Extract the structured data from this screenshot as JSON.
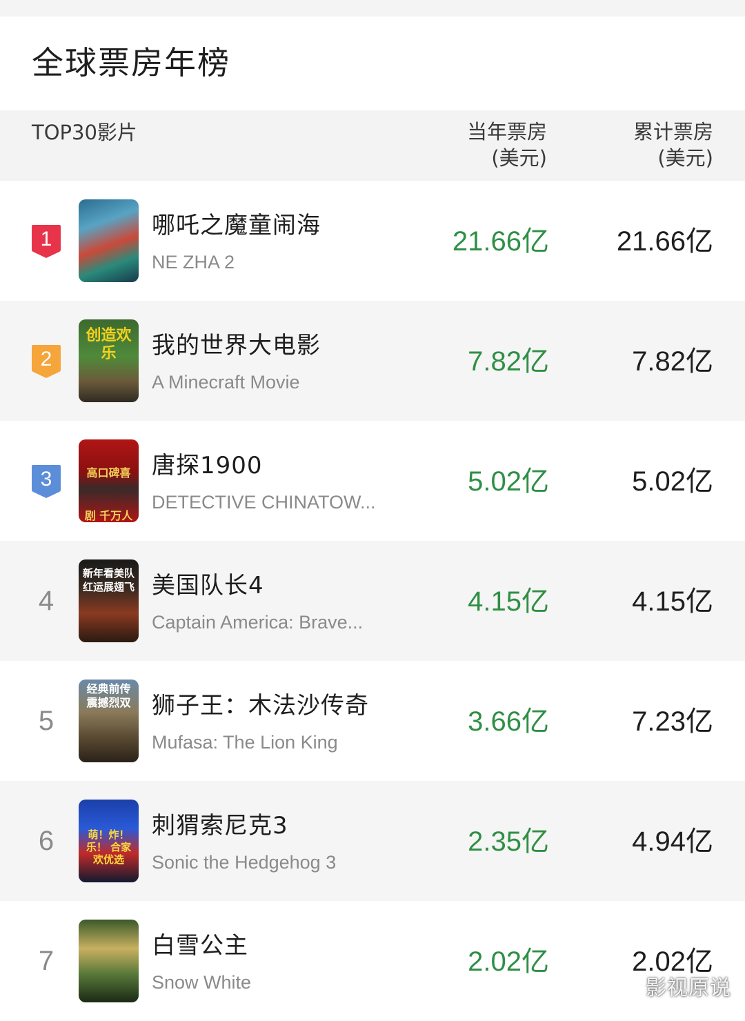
{
  "page": {
    "title": "全球票房年榜"
  },
  "table_header": {
    "film_col": "TOP30影片",
    "year_col": [
      "当年票房",
      "(美元)"
    ],
    "total_col": [
      "累计票房",
      "(美元)"
    ]
  },
  "colors": {
    "rank1": "#e8344a",
    "rank2": "#f5a53a",
    "rank3": "#5b8dd9",
    "green_value": "#2f8f45"
  },
  "movies": [
    {
      "rank": "1",
      "cn": "哪吒之魔童闹海",
      "en": "NE ZHA 2",
      "year": "21.66亿",
      "total": "21.66亿",
      "poster_text": ""
    },
    {
      "rank": "2",
      "cn": "我的世界大电影",
      "en": "A Minecraft Movie",
      "year": "7.82亿",
      "total": "7.82亿",
      "poster_text": "创造欢乐"
    },
    {
      "rank": "3",
      "cn": "唐探1900",
      "en": "DETECTIVE CHINATOW...",
      "year": "5.02亿",
      "total": "5.02亿",
      "poster_text": "高口碑喜剧 千万人催笑"
    },
    {
      "rank": "4",
      "cn": "美国队长4",
      "en": "Captain America: Brave...",
      "year": "4.15亿",
      "total": "4.15亿",
      "poster_text": "新年看美队 红运展翅飞"
    },
    {
      "rank": "5",
      "cn": "狮子王：木法沙传奇",
      "en": "Mufasa: The Lion King",
      "year": "3.66亿",
      "total": "7.23亿",
      "poster_text": "经典前传 震撼烈双"
    },
    {
      "rank": "6",
      "cn": "刺猬索尼克3",
      "en": "Sonic the Hedgehog 3",
      "year": "2.35亿",
      "total": "4.94亿",
      "poster_text": "萌！炸！乐！ 合家欢优选"
    },
    {
      "rank": "7",
      "cn": "白雪公主",
      "en": "Snow White",
      "year": "2.02亿",
      "total": "2.02亿",
      "poster_text": ""
    }
  ],
  "watermark": "影视原说"
}
